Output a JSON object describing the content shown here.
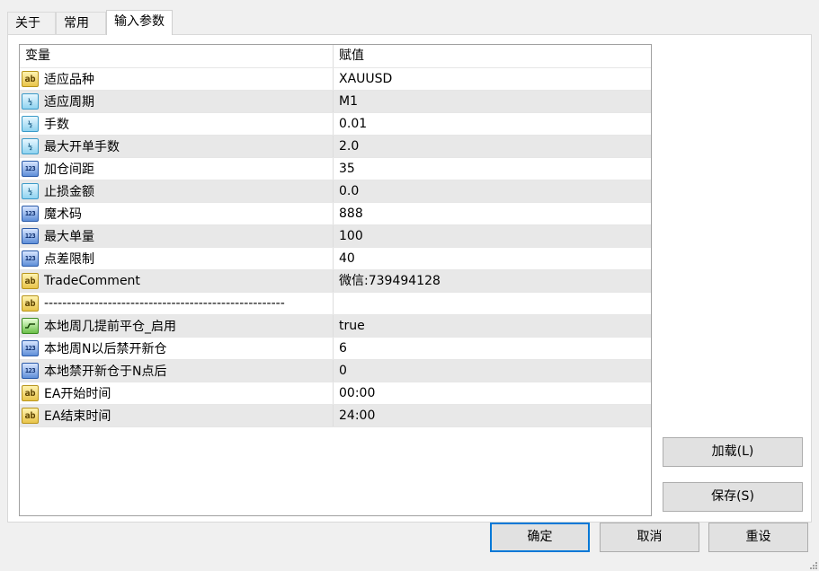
{
  "tabs": [
    {
      "label": "关于"
    },
    {
      "label": "常用"
    },
    {
      "label": "输入参数"
    }
  ],
  "grid": {
    "col_variable": "变量",
    "col_value": "赋值",
    "rows": [
      {
        "icon": "ab",
        "name": "适应品种",
        "value": "XAUUSD"
      },
      {
        "icon": "half",
        "name": "适应周期",
        "value": "M1"
      },
      {
        "icon": "half",
        "name": "手数",
        "value": "0.01"
      },
      {
        "icon": "half",
        "name": "最大开单手数",
        "value": "2.0"
      },
      {
        "icon": "n123",
        "name": "加仓间距",
        "value": "35"
      },
      {
        "icon": "half",
        "name": "止损金额",
        "value": "0.0"
      },
      {
        "icon": "n123",
        "name": "魔术码",
        "value": "888"
      },
      {
        "icon": "n123",
        "name": "最大单量",
        "value": "100"
      },
      {
        "icon": "n123",
        "name": "点差限制",
        "value": "40"
      },
      {
        "icon": "ab",
        "name": "TradeComment",
        "value": "微信:739494128"
      },
      {
        "icon": "ab",
        "name": "-----------------------------------------------------",
        "value": ""
      },
      {
        "icon": "bool",
        "name": "本地周几提前平仓_启用",
        "value": "true"
      },
      {
        "icon": "n123",
        "name": "本地周N以后禁开新仓",
        "value": "6"
      },
      {
        "icon": "n123",
        "name": "本地禁开新仓于N点后",
        "value": "0"
      },
      {
        "icon": "ab",
        "name": "EA开始时间",
        "value": "00:00"
      },
      {
        "icon": "ab",
        "name": "EA结束时间",
        "value": "24:00"
      }
    ]
  },
  "buttons": {
    "load": "加载(L)",
    "save": "保存(S)",
    "ok": "确定",
    "cancel": "取消",
    "reset": "重设"
  }
}
